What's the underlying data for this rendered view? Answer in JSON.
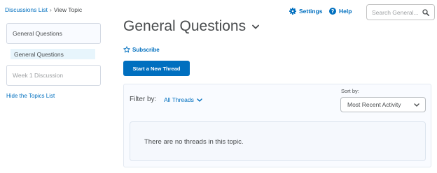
{
  "breadcrumb": {
    "link": "Discussions List",
    "separator": "›",
    "current": "View Topic"
  },
  "toolbar": {
    "settings_label": "Settings",
    "help_label": "Help"
  },
  "search": {
    "placeholder": "Search General..."
  },
  "sidebar": {
    "topics": [
      {
        "label": "General Questions",
        "state": "selected-forum"
      },
      {
        "label": "General Questions",
        "state": "selected-topic"
      },
      {
        "label": "Week 1 Discussion",
        "state": "muted"
      }
    ],
    "hide_link": "Hide the Topics List"
  },
  "main": {
    "title": "General Questions",
    "subscribe_label": "Subscribe",
    "new_thread_label": "Start a New Thread",
    "filter_label": "Filter by:",
    "filter_value": "All Threads",
    "sort_label": "Sort by:",
    "sort_value": "Most Recent Activity",
    "empty_message": "There are no threads in this topic."
  },
  "colors": {
    "accent": "#006fbf",
    "text": "#494c4e",
    "panel_bg": "#f9fbff",
    "selected_bg": "#e7f5fc"
  },
  "icons": {
    "settings": "gear-icon",
    "help": "help-circle-icon",
    "search": "search-icon",
    "subscribe": "star-icon",
    "dropdown": "chevron-down-icon"
  }
}
